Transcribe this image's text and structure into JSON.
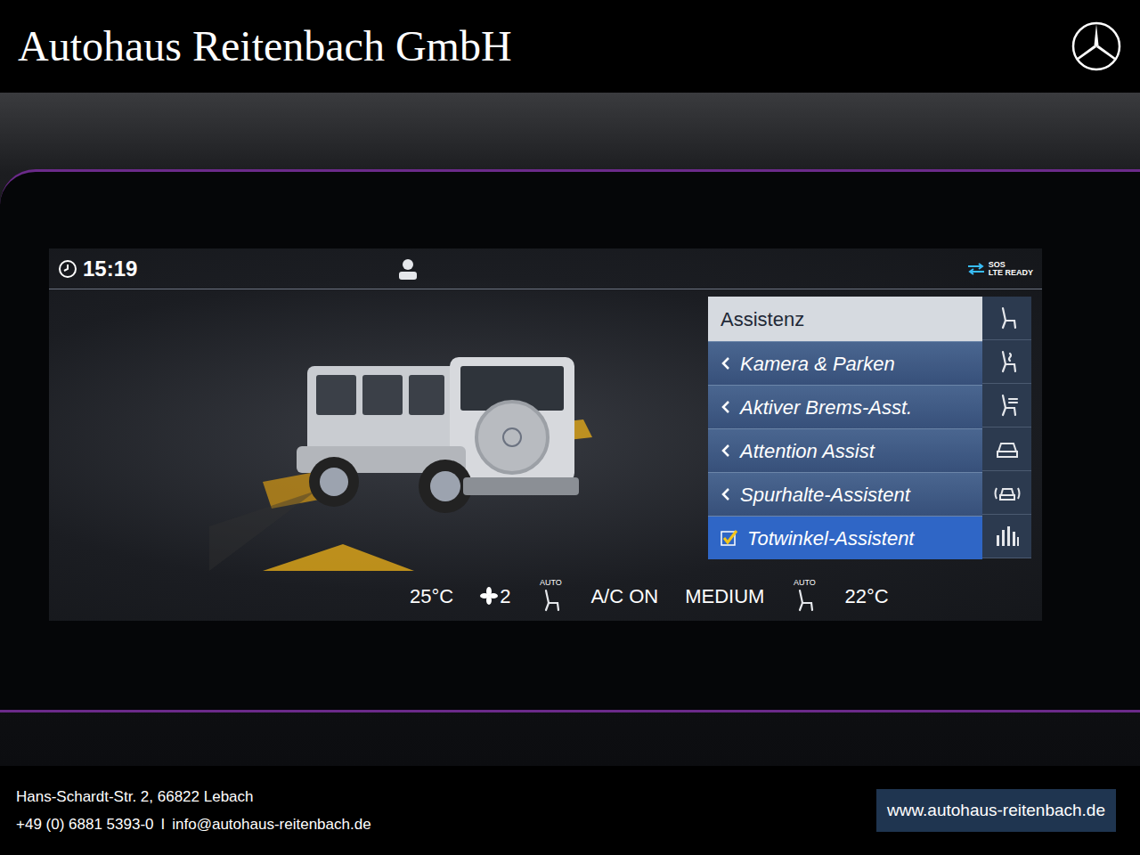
{
  "header": {
    "title": "Autohaus Reitenbach GmbH"
  },
  "display": {
    "time": "15:19",
    "status": {
      "top": "SOS",
      "bottom": "LTE READY"
    },
    "menu": {
      "title": "Assistenz",
      "items": [
        {
          "label": "Kamera & Parken",
          "kind": "submenu",
          "selected": false
        },
        {
          "label": "Aktiver Brems-Asst.",
          "kind": "submenu",
          "selected": false
        },
        {
          "label": "Attention Assist",
          "kind": "submenu",
          "selected": false
        },
        {
          "label": "Spurhalte-Assistent",
          "kind": "submenu",
          "selected": false
        },
        {
          "label": "Totwinkel-Assistent",
          "kind": "checkbox",
          "checked": true,
          "selected": true
        }
      ]
    },
    "climate": {
      "left_temp": "25°C",
      "fan_level": "2",
      "left_auto": "AUTO",
      "ac": "A/C ON",
      "mode": "MEDIUM",
      "right_auto": "AUTO",
      "right_temp": "22°C"
    }
  },
  "footer": {
    "address": "Hans-Schardt-Str. 2, 66822 Lebach",
    "phone": "+49 (0) 6881 5393-0",
    "separator": "I",
    "email": "info@autohaus-reitenbach.de",
    "website": "www.autohaus-reitenbach.de"
  }
}
